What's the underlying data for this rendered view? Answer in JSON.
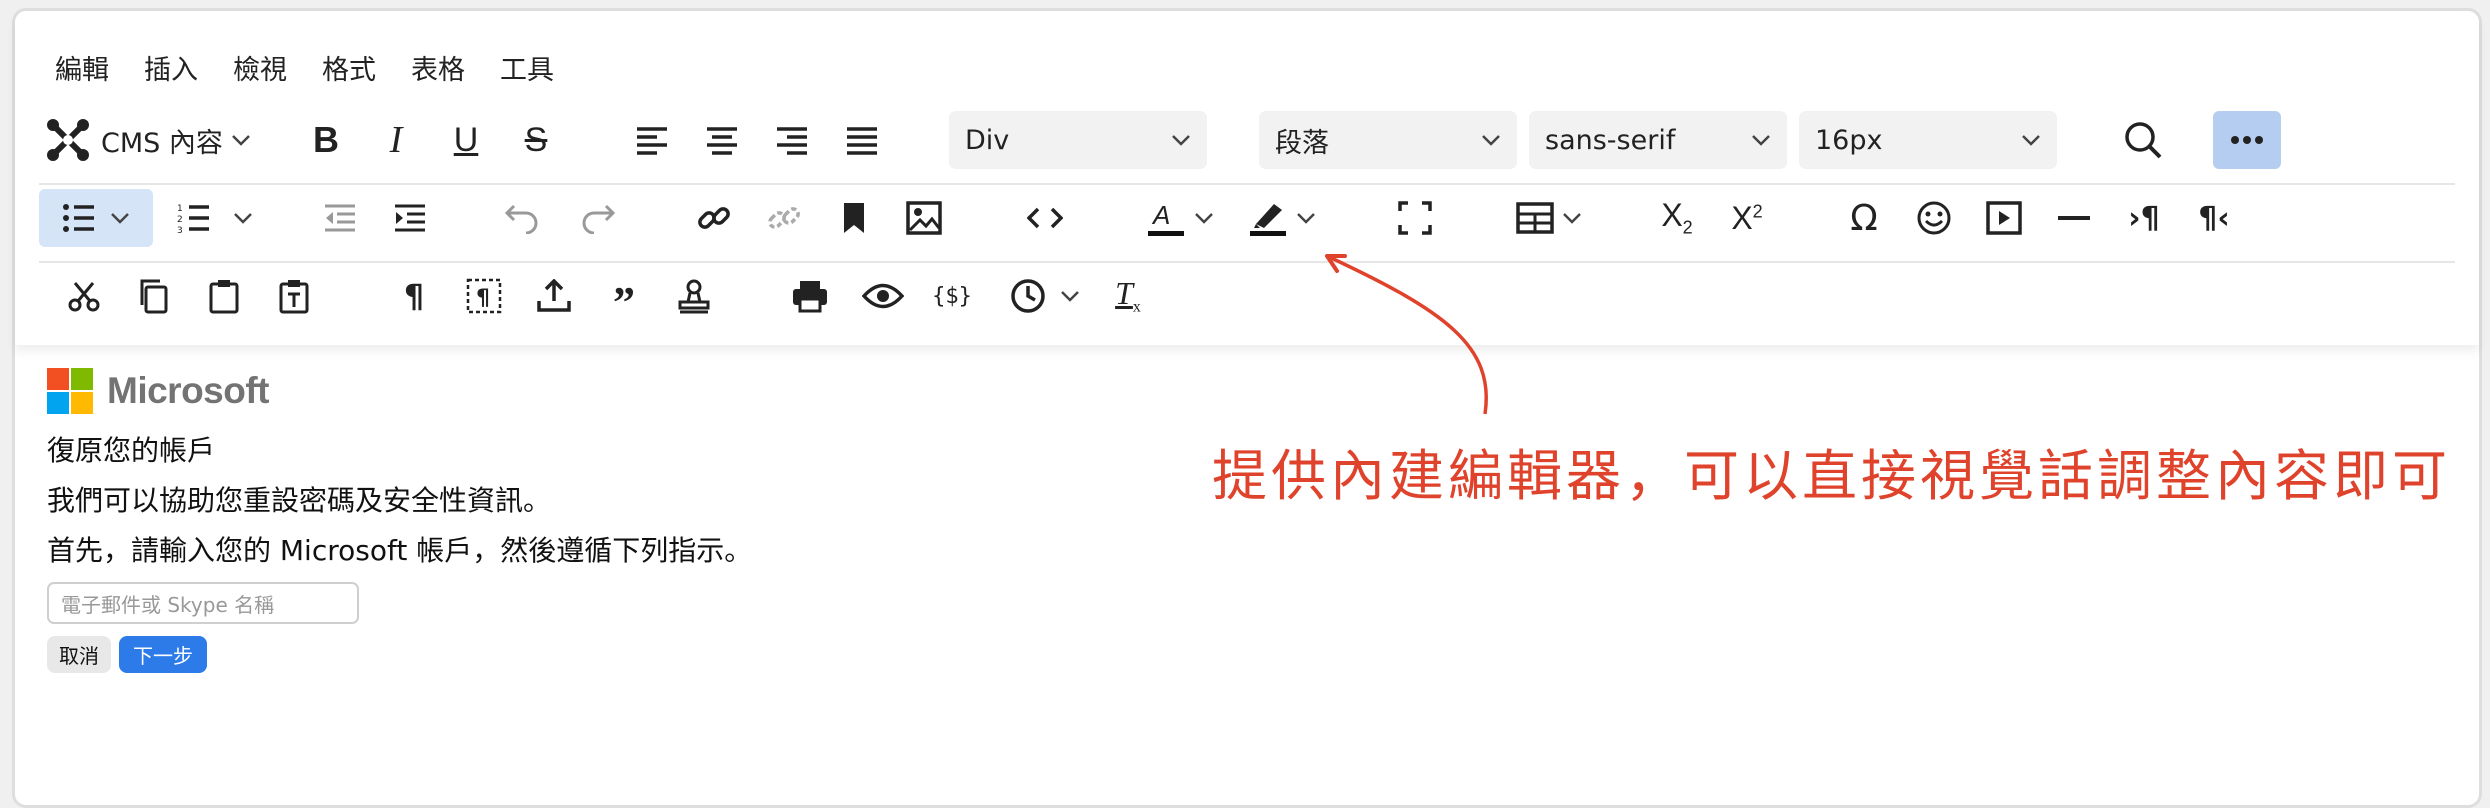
{
  "menubar": {
    "items": [
      "編輯",
      "插入",
      "檢視",
      "格式",
      "表格",
      "工具"
    ]
  },
  "toolbar": {
    "cms_label": "CMS 內容",
    "block_select": "Div",
    "format_select": "段落",
    "font_family": "sans-serif",
    "font_size": "16px"
  },
  "content": {
    "brand": "Microsoft",
    "heading": "復原您的帳戶",
    "line1": "我們可以協助您重設密碼及安全性資訊。",
    "line2": "首先，請輸入您的 Microsoft 帳戶，然後遵循下列指示。",
    "email_placeholder": "電子郵件或 Skype 名稱",
    "cancel_label": "取消",
    "next_label": "下一步"
  },
  "annotation": {
    "text": "提供內建編輯器，可以直接視覺話調整內容即可"
  },
  "colors": {
    "accent": "#2d7be8",
    "annotation": "#e0432c",
    "active_button": "#d6e4f8",
    "ms_red": "#f25022",
    "ms_green": "#7fba00",
    "ms_blue": "#00a4ef",
    "ms_yellow": "#ffb900"
  }
}
